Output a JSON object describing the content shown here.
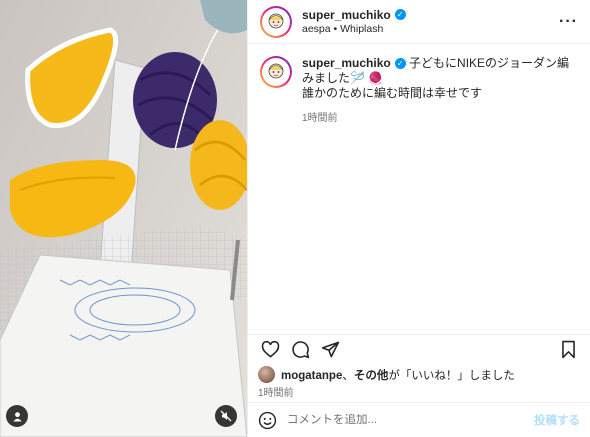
{
  "post": {
    "username": "super_muchiko",
    "music": "aespa • Whiplash",
    "caption_line1": "子どもにNIKEのジョーダン編みました🪡 🧶",
    "caption_line2": "誰かのために編む時間は幸せです",
    "caption_time": "1時間前"
  },
  "likes": {
    "liker": "mogatanpe",
    "separator": "、",
    "others": "その他",
    "suffix": "が「いいね！」しました"
  },
  "post_time": "1時間前",
  "comment": {
    "placeholder": "コメントを追加...",
    "post_label": "投稿する"
  },
  "icons": {
    "more": "more-options-icon",
    "like": "heart-icon",
    "comment": "comment-icon",
    "share": "share-icon",
    "save": "bookmark-icon",
    "emoji": "emoji-icon",
    "user_tag": "user-tag-icon",
    "mute": "mute-icon"
  },
  "colors": {
    "accent": "#0095f6",
    "post_disabled": "#b2dffc",
    "yarn_yellow": "#f6b91a",
    "yarn_purple": "#3d2a6b"
  }
}
